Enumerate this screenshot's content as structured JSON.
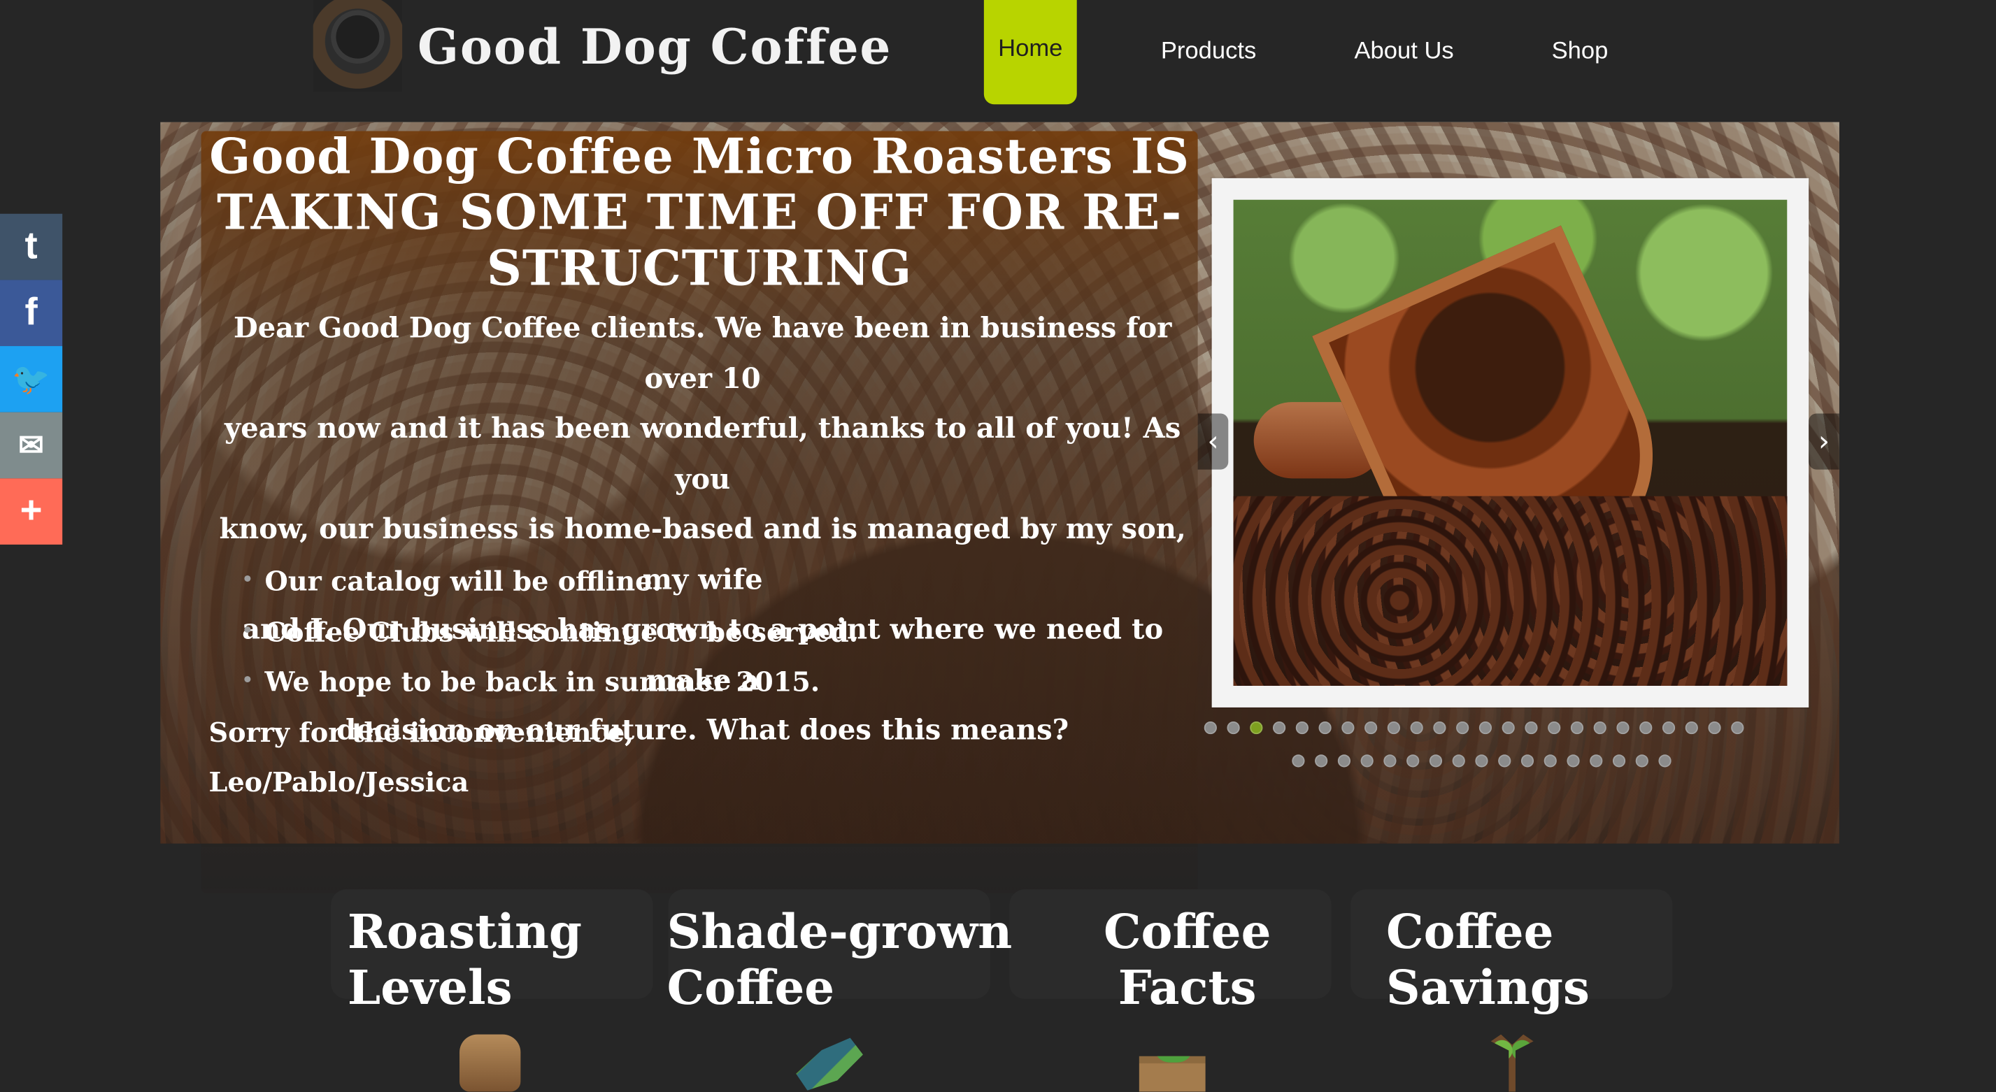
{
  "site": {
    "brand": "Good Dog Coffee"
  },
  "nav": {
    "home": "Home",
    "products": "Products",
    "about": "About Us",
    "shop": "Shop"
  },
  "share": {
    "tumblr": "t",
    "facebook": "f",
    "twitter": "🐦",
    "email": "✉",
    "more": "+"
  },
  "hero": {
    "headline_1": "Good Dog Coffee Micro Roasters IS",
    "headline_2": "TAKING SOME TIME OFF FOR RE-",
    "headline_3": "STRUCTURING",
    "paragraph_1": "Dear Good Dog Coffee clients. We have been in business for over 10",
    "paragraph_2": "years now and it has been wonderful, thanks to all of you! As you",
    "paragraph_3": "know, our business is home-based and is managed by my son, my wife",
    "paragraph_4": "and I. Our business has grown to a point where we need to make a",
    "paragraph_5": "decision on our future. What does this means?",
    "bullet_1": "Our catalog will be offline.",
    "bullet_2": "Coffee Clubs will continue to be served.",
    "bullet_3": "We hope to be back in summer 2015.",
    "sorry": "Sorry for the inconvenience,",
    "signature": "Leo/Pablo/Jessica"
  },
  "slider": {
    "left_arrow": "‹",
    "right_arrow": "›"
  },
  "cards": [
    {
      "title_1": "Roasting",
      "title_2": "Levels"
    },
    {
      "title_1": "Shade-grown",
      "title_2": "Coffee"
    },
    {
      "title_1": "Coffee",
      "title_2": "Facts"
    },
    {
      "title_1": "Coffee",
      "title_2": "Savings"
    }
  ]
}
